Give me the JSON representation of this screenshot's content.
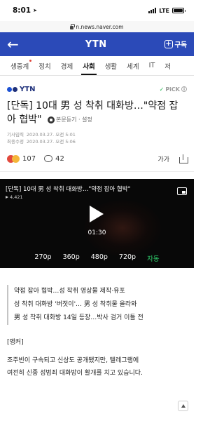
{
  "status_bar": {
    "time": "8:01",
    "network": "LTE"
  },
  "url": "n.news.naver.com",
  "header": {
    "logo": "YTN",
    "subscribe_label": "구독"
  },
  "categories": [
    {
      "label": "생중계",
      "active": false
    },
    {
      "label": "정치",
      "active": false
    },
    {
      "label": "경제",
      "active": false
    },
    {
      "label": "사회",
      "active": true
    },
    {
      "label": "생활",
      "active": false
    },
    {
      "label": "세계",
      "active": false
    },
    {
      "label": "IT",
      "active": false
    },
    {
      "label": "저",
      "active": false
    }
  ],
  "press": {
    "name": "YTN",
    "pick_label": "PiCK"
  },
  "article": {
    "title": "[단독] 10대 男 성 착취 대화방…\"약점 잡아 협박\"",
    "tts_label": "본문듣기 · 설정",
    "published_label": "기사입력",
    "published": "2020.03.27. 오전 5:01",
    "modified_label": "최종수정",
    "modified": "2020.03.27. 오전 5:06"
  },
  "reactions": {
    "emotion_count": "107",
    "comment_count": "42",
    "font_label": "가가"
  },
  "video": {
    "title": "[단독] 10대 男 성 착취 대화방…\"약점 잡아 협박\"",
    "views": "4,421",
    "duration": "01:30",
    "qualities": [
      "270p",
      "360p",
      "480p",
      "720p",
      "자동"
    ]
  },
  "summary": [
    "약점 잡아 협박…성 착취 영상물 제작·유포",
    "성 착취 대화방 '버젓이'… 男 성 착취물 올라와",
    "男 성 착취 대화방 14일 등장…박사 검거 이틀 전"
  ],
  "body": [
    "[앵커]",
    "조주빈이 구속되고 신상도 공개됐지만, 텔레그램에",
    "여전히 신종 성범죄 대화방이 활개를 치고 있습니다."
  ],
  "colors": {
    "brand_header": "#2b4ab8",
    "auto_quality": "#2fd06d"
  }
}
